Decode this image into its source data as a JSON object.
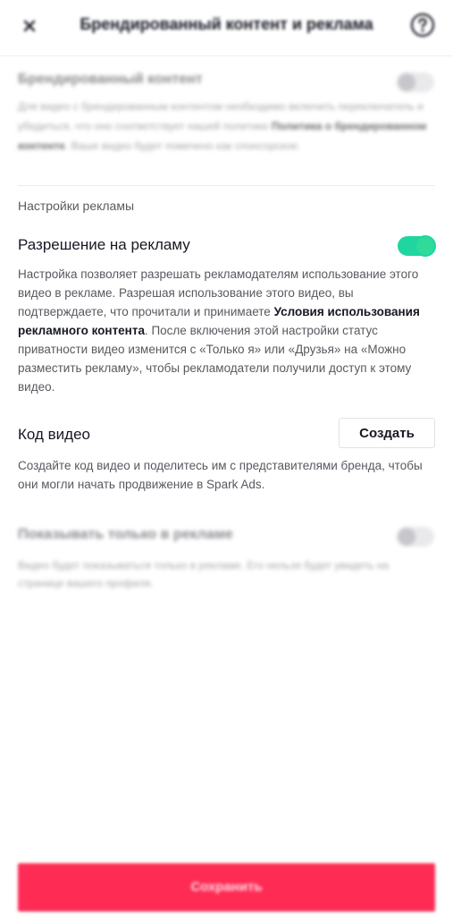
{
  "header": {
    "title": "Брендированный контент и реклама",
    "close_icon": "close-icon",
    "help_icon": "help-icon"
  },
  "branded_content": {
    "title": "Брендированный контент",
    "desc_prefix": "Для видео с брендированным контентом необходимо включить переключатель и убедиться, что оно соответствует нашей политике ",
    "desc_link": "Политика о брендированном контенте",
    "desc_suffix": ". Ваше видео будет помечено как спонсорское.",
    "enabled": false
  },
  "ad_settings": {
    "section_label": "Настройки рекламы",
    "permission_title": "Разрешение на рекламу",
    "permission_enabled": true,
    "desc_prefix": "Настройка позволяет разрешать рекламодателям использование этого видео в рекламе. Разрешая использование этого видео, вы подтверждаете, что прочитали и принимаете ",
    "desc_link": "Условия использования рекламного контента",
    "desc_suffix": ". После включения этой настройки статус приватности видео изменится с «Только я» или «Друзья» на «Можно разместить рекламу», чтобы рекламодатели получили доступ к этому видео."
  },
  "video_code": {
    "title": "Код видео",
    "create_label": "Создать",
    "desc": "Создайте код видео и поделитесь им с представителями бренда, чтобы они могли начать продвижение в Spark Ads."
  },
  "ads_only": {
    "title": "Показывать только в рекламе",
    "desc": "Видео будет показываться только в рекламе. Его нельзя будет увидеть на странице вашего профиля.",
    "enabled": false
  },
  "footer": {
    "save_label": "Сохранить"
  },
  "colors": {
    "accent": "#fe2c55",
    "toggle_on": "#20d5a0"
  }
}
